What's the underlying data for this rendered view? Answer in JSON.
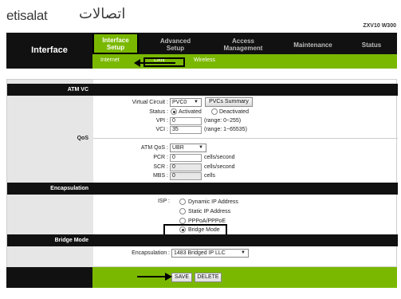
{
  "header": {
    "logo_en": "etisalat",
    "logo_ar": "اتصالات",
    "model": "ZXV10 W300"
  },
  "nav": {
    "title": "Interface",
    "tabs": [
      {
        "label": "Interface Setup"
      },
      {
        "label": "Advanced Setup"
      },
      {
        "label": "Access Management"
      },
      {
        "label": "Maintenance"
      },
      {
        "label": "Status"
      }
    ],
    "subtabs": [
      {
        "label": "Internet"
      },
      {
        "label": "LAN"
      },
      {
        "label": "Wireless"
      }
    ]
  },
  "sections": {
    "atm_vc": "ATM VC",
    "qos": "QoS",
    "encapsulation": "Encapsulation",
    "bridge_mode": "Bridge Mode"
  },
  "atm": {
    "virtual_circuit_label": "Virtual Circuit :",
    "virtual_circuit_value": "PVC0",
    "pvcs_summary": "PVCs Summary",
    "status_label": "Status :",
    "status_activated": "Activated",
    "status_deactivated": "Deactivated",
    "vpi_label": "VPI :",
    "vpi_value": "0",
    "vpi_range": "(range: 0~255)",
    "vci_label": "VCI :",
    "vci_value": "35",
    "vci_range": "(range: 1~65535)"
  },
  "qos": {
    "atm_qos_label": "ATM QoS :",
    "atm_qos_value": "UBR",
    "pcr_label": "PCR :",
    "pcr_value": "0",
    "pcr_unit": "cells/second",
    "scr_label": "SCR :",
    "scr_value": "0",
    "scr_unit": "cells/second",
    "mbs_label": "MBS :",
    "mbs_value": "0",
    "mbs_unit": "cells"
  },
  "isp": {
    "label": "ISP :",
    "options": [
      "Dynamic IP Address",
      "Static IP Address",
      "PPPoA/PPPoE",
      "Bridge Mode"
    ],
    "selected": "Bridge Mode"
  },
  "bridge": {
    "encapsulation_label": "Encapsulation :",
    "encapsulation_value": "1483 Bridged IP LLC"
  },
  "footer": {
    "save": "SAVE",
    "delete": "DELETE"
  }
}
